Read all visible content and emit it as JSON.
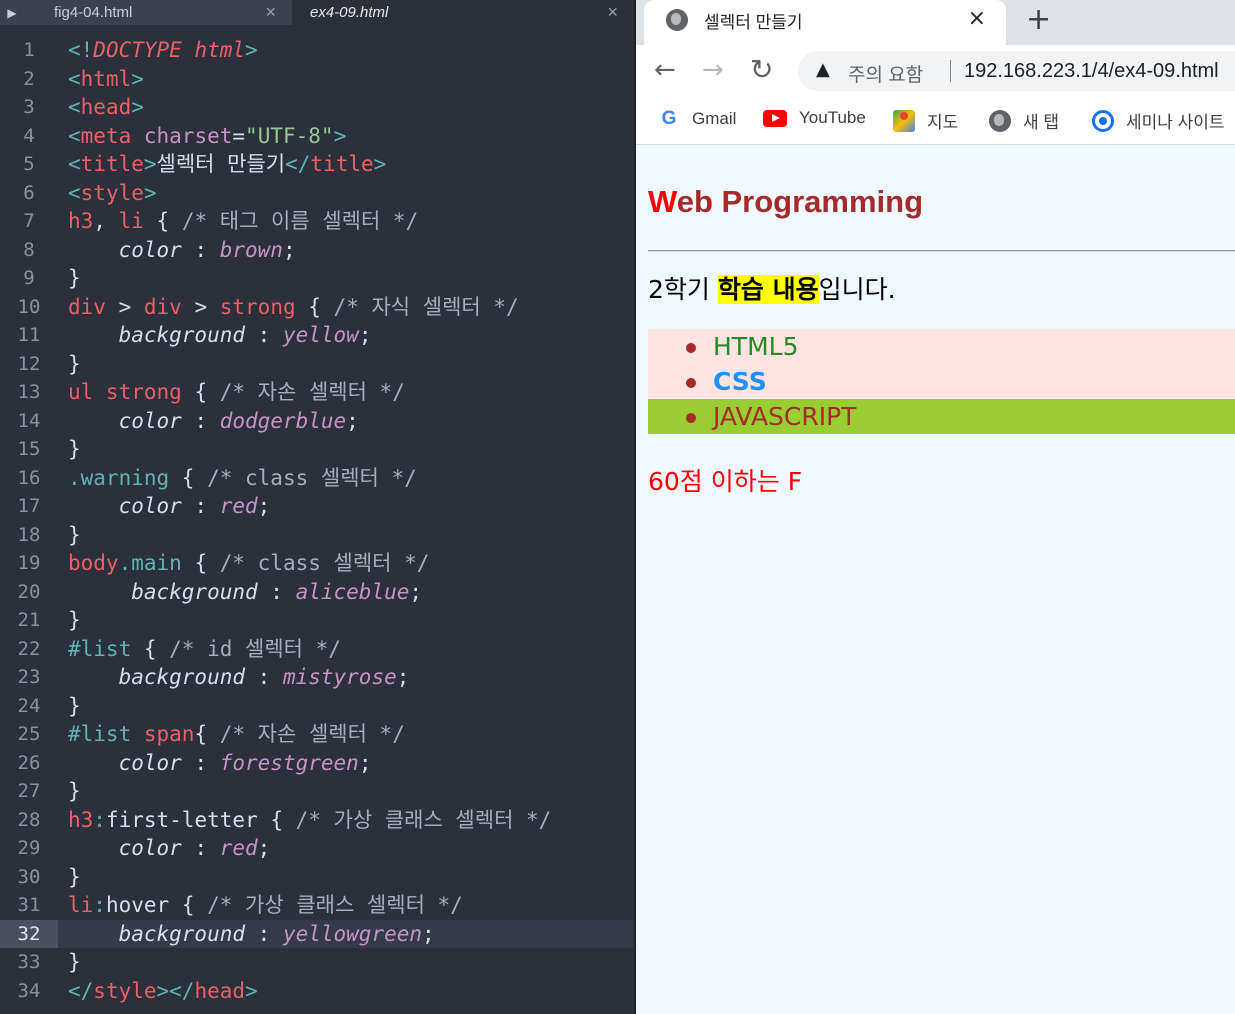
{
  "editor": {
    "tabs": [
      {
        "name": "fig4-04.html",
        "close": "×"
      },
      {
        "name": "ex4-09.html",
        "close": "×"
      }
    ],
    "play_glyph": "▶",
    "current_line": 32,
    "lines": [
      [
        [
          "c-punct",
          "<!"
        ],
        [
          "c-italic-tag",
          "DOCTYPE html"
        ],
        [
          "c-punct",
          ">"
        ]
      ],
      [
        [
          "c-punct",
          "<"
        ],
        [
          "c-tag",
          "html"
        ],
        [
          "c-punct",
          ">"
        ]
      ],
      [
        [
          "c-punct",
          "<"
        ],
        [
          "c-tag",
          "head"
        ],
        [
          "c-punct",
          ">"
        ]
      ],
      [
        [
          "c-punct",
          "<"
        ],
        [
          "c-tag",
          "meta "
        ],
        [
          "c-attr",
          "charset"
        ],
        [
          "c-plain",
          "="
        ],
        [
          "c-str",
          "\"UTF-8\""
        ],
        [
          "c-punct",
          ">"
        ]
      ],
      [
        [
          "c-punct",
          "<"
        ],
        [
          "c-tag",
          "title"
        ],
        [
          "c-punct",
          ">"
        ],
        [
          "c-plain",
          "셀렉터 만들기"
        ],
        [
          "c-punct",
          "</"
        ],
        [
          "c-tag",
          "title"
        ],
        [
          "c-punct",
          ">"
        ]
      ],
      [
        [
          "c-punct",
          "<"
        ],
        [
          "c-tag",
          "style"
        ],
        [
          "c-punct",
          ">"
        ]
      ],
      [
        [
          "c-sel",
          "h3"
        ],
        [
          "c-plain",
          ", "
        ],
        [
          "c-sel",
          "li"
        ],
        [
          "c-plain",
          " { "
        ],
        [
          "c-cmt",
          "/* 태그 이름 셀렉터 */"
        ]
      ],
      [
        [
          "c-plain",
          "    "
        ],
        [
          "c-prop",
          "color"
        ],
        [
          "c-plain",
          " : "
        ],
        [
          "c-val",
          "brown"
        ],
        [
          "c-plain",
          ";"
        ]
      ],
      [
        [
          "c-plain",
          "}"
        ]
      ],
      [
        [
          "c-sel",
          "div"
        ],
        [
          "c-plain",
          " > "
        ],
        [
          "c-sel",
          "div"
        ],
        [
          "c-plain",
          " > "
        ],
        [
          "c-sel",
          "strong"
        ],
        [
          "c-plain",
          " { "
        ],
        [
          "c-cmt",
          "/* 자식 셀렉터 */"
        ]
      ],
      [
        [
          "c-plain",
          "    "
        ],
        [
          "c-prop",
          "background"
        ],
        [
          "c-plain",
          " : "
        ],
        [
          "c-val",
          "yellow"
        ],
        [
          "c-plain",
          ";"
        ]
      ],
      [
        [
          "c-plain",
          "}"
        ]
      ],
      [
        [
          "c-sel",
          "ul strong"
        ],
        [
          "c-plain",
          " { "
        ],
        [
          "c-cmt",
          "/* 자손 셀렉터 */"
        ]
      ],
      [
        [
          "c-plain",
          "    "
        ],
        [
          "c-prop",
          "color"
        ],
        [
          "c-plain",
          " : "
        ],
        [
          "c-val",
          "dodgerblue"
        ],
        [
          "c-plain",
          ";"
        ]
      ],
      [
        [
          "c-plain",
          "}"
        ]
      ],
      [
        [
          "c-class",
          ".warning"
        ],
        [
          "c-plain",
          " { "
        ],
        [
          "c-cmt",
          "/* class 셀렉터 */"
        ]
      ],
      [
        [
          "c-plain",
          "    "
        ],
        [
          "c-prop",
          "color"
        ],
        [
          "c-plain",
          " : "
        ],
        [
          "c-val",
          "red"
        ],
        [
          "c-plain",
          ";"
        ]
      ],
      [
        [
          "c-plain",
          "}"
        ]
      ],
      [
        [
          "c-sel",
          "body"
        ],
        [
          "c-class",
          ".main"
        ],
        [
          "c-plain",
          " { "
        ],
        [
          "c-cmt",
          "/* class 셀렉터 */"
        ]
      ],
      [
        [
          "c-plain",
          "     "
        ],
        [
          "c-prop",
          "background"
        ],
        [
          "c-plain",
          " : "
        ],
        [
          "c-val",
          "aliceblue"
        ],
        [
          "c-plain",
          ";"
        ]
      ],
      [
        [
          "c-plain",
          "}"
        ]
      ],
      [
        [
          "c-class",
          "#list"
        ],
        [
          "c-plain",
          " { "
        ],
        [
          "c-cmt",
          "/* id 셀렉터 */"
        ]
      ],
      [
        [
          "c-plain",
          "    "
        ],
        [
          "c-prop",
          "background"
        ],
        [
          "c-plain",
          " : "
        ],
        [
          "c-val",
          "mistyrose"
        ],
        [
          "c-plain",
          ";"
        ]
      ],
      [
        [
          "c-plain",
          "}"
        ]
      ],
      [
        [
          "c-class",
          "#list "
        ],
        [
          "c-sel",
          "span"
        ],
        [
          "c-plain",
          "{ "
        ],
        [
          "c-cmt",
          "/* 자손 셀렉터 */"
        ]
      ],
      [
        [
          "c-plain",
          "    "
        ],
        [
          "c-prop",
          "color"
        ],
        [
          "c-plain",
          " : "
        ],
        [
          "c-val",
          "forestgreen"
        ],
        [
          "c-plain",
          ";"
        ]
      ],
      [
        [
          "c-plain",
          "}"
        ]
      ],
      [
        [
          "c-sel",
          "h3"
        ],
        [
          "c-class",
          ":"
        ],
        [
          "c-pseudo",
          "first-letter"
        ],
        [
          "c-plain",
          " { "
        ],
        [
          "c-cmt",
          "/* 가상 클래스 셀렉터 */"
        ]
      ],
      [
        [
          "c-plain",
          "    "
        ],
        [
          "c-prop",
          "color"
        ],
        [
          "c-plain",
          " : "
        ],
        [
          "c-val",
          "red"
        ],
        [
          "c-plain",
          ";"
        ]
      ],
      [
        [
          "c-plain",
          "}"
        ]
      ],
      [
        [
          "c-sel",
          "li"
        ],
        [
          "c-class",
          ":"
        ],
        [
          "c-pseudo",
          "hover"
        ],
        [
          "c-plain",
          " { "
        ],
        [
          "c-cmt",
          "/* 가상 클래스 셀렉터 */"
        ]
      ],
      [
        [
          "c-plain",
          "    "
        ],
        [
          "c-prop",
          "background"
        ],
        [
          "c-plain",
          " : "
        ],
        [
          "c-val",
          "yellowgreen"
        ],
        [
          "c-plain",
          ";"
        ]
      ],
      [
        [
          "c-plain",
          "}"
        ]
      ],
      [
        [
          "c-punct",
          "</"
        ],
        [
          "c-tag",
          "style"
        ],
        [
          "c-punct",
          "></"
        ],
        [
          "c-tag",
          "head"
        ],
        [
          "c-punct",
          ">"
        ]
      ]
    ]
  },
  "browser": {
    "tab_title": "셀렉터 만들기",
    "tab_close": "×",
    "new_tab": "+",
    "nav": {
      "back": "←",
      "forward": "→",
      "reload": "↻"
    },
    "security_icon": "▲",
    "security_text": "주의 요함",
    "url": "192.168.223.1/4/ex4-09.html",
    "bookmarks": [
      {
        "icon": "google-icon",
        "label": "Gmail"
      },
      {
        "icon": "youtube-icon",
        "label": "YouTube"
      },
      {
        "icon": "maps-icon",
        "label": "지도"
      },
      {
        "icon": "globe-icon",
        "label": "새 탭"
      },
      {
        "icon": "chromium-icon",
        "label": "세미나 사이트"
      }
    ]
  },
  "page": {
    "heading_first": "W",
    "heading_rest": "eb Programming",
    "para_before": "2학기 ",
    "para_strong": "학습 내용",
    "para_after": "입니다.",
    "list": [
      {
        "text": "HTML5",
        "style": "span"
      },
      {
        "text": "CSS",
        "style": "strong"
      },
      {
        "text": "JAVASCRIPT",
        "style": "hover"
      }
    ],
    "warning": "60점 이하는 F"
  },
  "colors": {
    "editor_bg": "#2b303b",
    "aliceblue": "#f0f8ff",
    "mistyrose": "#ffe4e1",
    "yellowgreen": "#9acd32",
    "brown": "#a52a2a",
    "forestgreen": "#228b22",
    "dodgerblue": "#1e90ff",
    "red": "#ff0000",
    "yellow": "#ffff00"
  }
}
